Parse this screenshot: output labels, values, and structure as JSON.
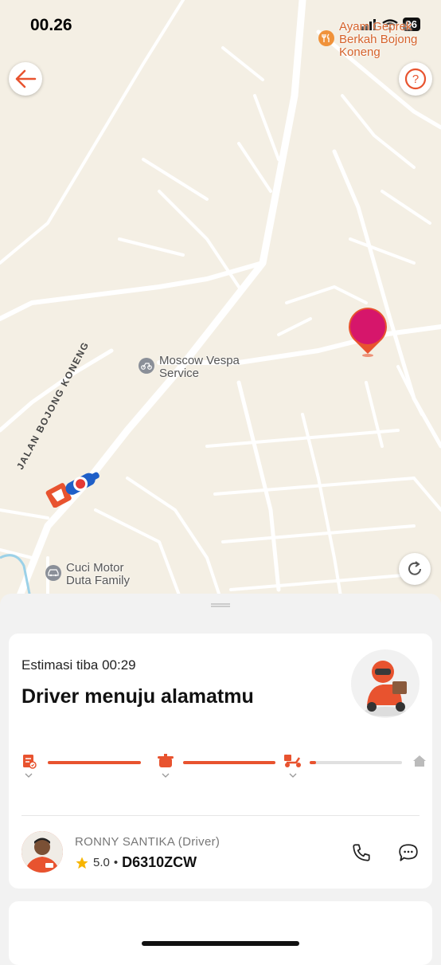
{
  "status_bar": {
    "time": "00.26",
    "battery": "96"
  },
  "map": {
    "poi_restaurant": {
      "line1": "Ayam Geprek",
      "line2": "Berkah Bojong",
      "line3": "Koneng",
      "icon": "restaurant-icon"
    },
    "poi_vespa": {
      "line1": "Moscow Vespa",
      "line2": "Service",
      "icon": "bike-icon"
    },
    "poi_car": {
      "line1": "Cuci Motor",
      "line2": "Duta Family",
      "icon": "car-icon"
    },
    "street_label": "JALAN BOJONG KONENG"
  },
  "colors": {
    "accent": "#e8532f",
    "pin": "#d6166b",
    "map_bg": "#f4efe4"
  },
  "order": {
    "eta_label": "Estimasi tiba 00:29",
    "headline": "Driver menuju alamatmu",
    "steps": [
      "order-confirmed-icon",
      "cooking-pot-icon",
      "scooter-icon",
      "home-icon"
    ],
    "progress_fraction": 0.68
  },
  "driver": {
    "name": "RONNY SANTIKA (Driver)",
    "rating": "5.0",
    "separator": "•",
    "plate": "D6310ZCW"
  }
}
